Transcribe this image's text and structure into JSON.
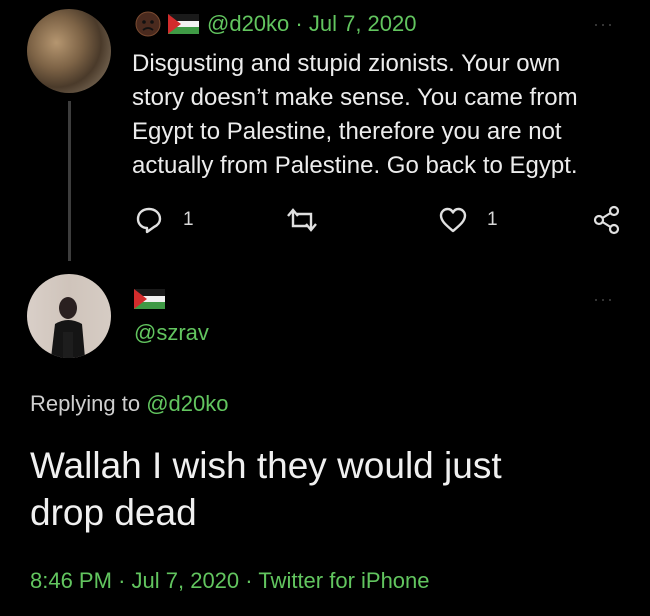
{
  "tweet1": {
    "handle": "@d20ko",
    "date": "· Jul 7, 2020",
    "text_lines": [
      "Disgusting and stupid zionists. Your own",
      "story doesn’t make sense. You came from",
      "Egypt to Palestine, therefore you are not",
      "actually from Palestine. Go back to Egypt."
    ],
    "reply_count": "1",
    "like_count": "1",
    "more": "···"
  },
  "tweet2": {
    "handle": "@szrav",
    "replying_prefix": "Replying to ",
    "replying_handle": "@d20ko",
    "text_lines": [
      "Wallah I wish they would just",
      "drop dead"
    ],
    "time": "8:46 PM",
    "date": "Jul 7, 2020",
    "source": "Twitter for iPhone",
    "sep": "·",
    "more": "···"
  },
  "colors": {
    "accent": "#62c55f",
    "text": "#ececec",
    "background": "#000000"
  }
}
